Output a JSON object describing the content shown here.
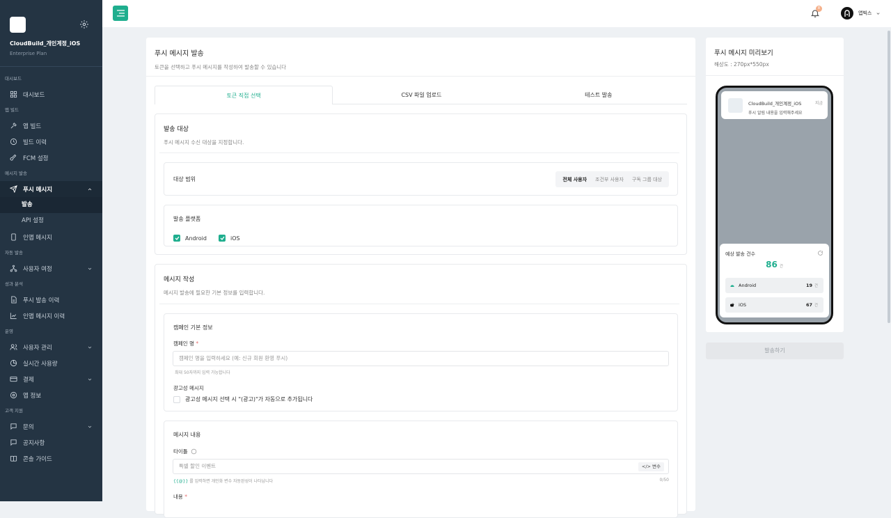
{
  "sidebar": {
    "app_name": "CloudBuild_개인계정_iOS",
    "plan": "Enterprise Plan",
    "sections": {
      "dashboard": "대시보드",
      "app_build": "앱 빌드",
      "message_send": "메시지 발송",
      "auto_send": "자동 발송",
      "analytics": "성과 분석",
      "operations": "운영",
      "support": "고객 지원"
    },
    "items": {
      "dashboard": "대시보드",
      "app_build": "앱 빌드",
      "build_history": "빌드 이력",
      "fcm": "FCM 설정",
      "push": "푸시 메시지",
      "push_send": "발송",
      "push_api": "API 설정",
      "inapp": "인앱 메시지",
      "journey": "사용자 여정",
      "push_history": "푸시 발송 이력",
      "inapp_history": "인앱 메시지 이력",
      "user_mgmt": "사용자 관리",
      "realtime": "실시간 사용량",
      "billing": "결제",
      "app_info": "앱 정보",
      "inquiry": "문의",
      "notice": "공지사항",
      "console_guide": "콘솔 가이드"
    }
  },
  "topbar": {
    "badge": "8",
    "user_name": "앱빅스"
  },
  "main": {
    "title": "푸시 메시지 발송",
    "subtitle": "토큰을 선택하고 푸시 메시지를 작성하여 발송할 수 있습니다",
    "tabs": [
      "토큰 직접 선택",
      "CSV 파일 업로드",
      "테스트 발송"
    ],
    "target": {
      "title": "발송 대상",
      "subtitle": "푸시 메시지 수신 대상을 지정합니다.",
      "scope_label": "대상 범위",
      "scope_options": [
        "전체 사용자",
        "조건부 사용자",
        "구독 그룹 대상"
      ],
      "platform_label": "발송 플랫폼",
      "platforms": [
        "Android",
        "iOS"
      ]
    },
    "compose": {
      "title": "메시지 작성",
      "subtitle": "메시지 발송에 필요한 기본 정보를 입력합니다.",
      "campaign_section": "캠페인 기본 정보",
      "campaign_label": "캠페인 명",
      "required_mark": "*",
      "campaign_placeholder": "캠페인 명을 입력하세요 (예: 신규 회원 환영 푸시)",
      "campaign_hint": "최대 50자까지 입력 가능합니다",
      "ad_label": "광고성 메시지",
      "ad_checkbox": "광고성 메시지 선택 시 \"(광고)\"가 자동으로 추가됩니다",
      "content_section": "메시지 내용",
      "title_label": "타이틀",
      "title_placeholder": "특별 할인 이벤트",
      "var_button": "</> 변수",
      "var_hint_code": "{{@}}",
      "var_hint": " 를 입력하면 개인화 변수 자동완성이 나타납니다",
      "counter": "0/50",
      "body_label": "내용"
    }
  },
  "preview": {
    "title": "푸시 메시지 미리보기",
    "resolution": "해상도 : 270px*550px",
    "notif_app": "CloudBuild_개인계정_iOS",
    "notif_time": "지금",
    "notif_body": "푸시 알림 내용을 입력해주세요",
    "est_title": "예상 발송 건수",
    "est_total": "86",
    "unit": "건",
    "android_label": "Android",
    "android_count": "19",
    "ios_label": "iOS",
    "ios_count": "67",
    "send_button": "발송하기"
  }
}
